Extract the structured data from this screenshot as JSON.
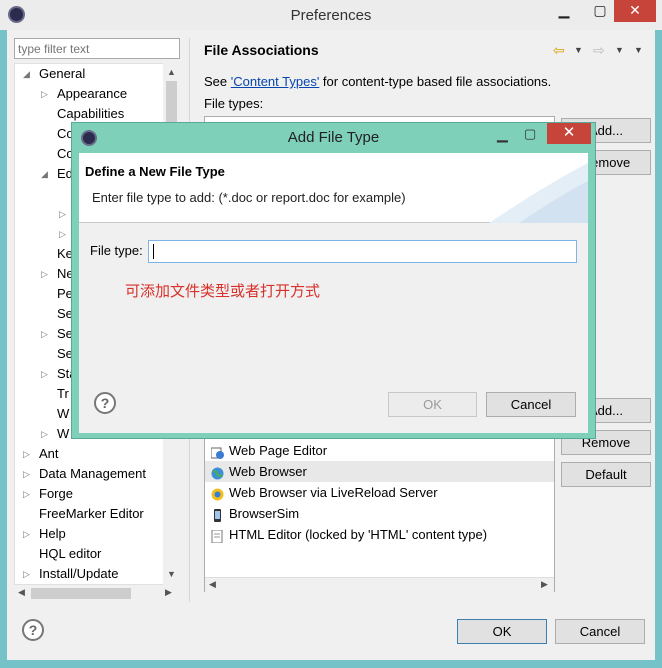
{
  "window": {
    "title": "Preferences"
  },
  "filter": {
    "placeholder": "type filter text"
  },
  "tree": [
    {
      "label": "General",
      "arrow": "◢",
      "indent": 0
    },
    {
      "label": "Appearance",
      "arrow": "▷",
      "indent": 1
    },
    {
      "label": "Capabilities",
      "arrow": "",
      "indent": 1
    },
    {
      "label": "Co",
      "arrow": "",
      "indent": 1
    },
    {
      "label": "Co",
      "arrow": "",
      "indent": 1
    },
    {
      "label": "Ed",
      "arrow": "◢",
      "indent": 1
    },
    {
      "label": "",
      "arrow": "",
      "indent": 2
    },
    {
      "label": "",
      "arrow": "▷",
      "indent": 2
    },
    {
      "label": "",
      "arrow": "▷",
      "indent": 2
    },
    {
      "label": "Ke",
      "arrow": "",
      "indent": 1
    },
    {
      "label": "Ne",
      "arrow": "▷",
      "indent": 1
    },
    {
      "label": "Pe",
      "arrow": "",
      "indent": 1
    },
    {
      "label": "Se",
      "arrow": "",
      "indent": 1
    },
    {
      "label": "Se",
      "arrow": "▷",
      "indent": 1
    },
    {
      "label": "Se",
      "arrow": "",
      "indent": 1
    },
    {
      "label": "Sta",
      "arrow": "▷",
      "indent": 1
    },
    {
      "label": "Tr",
      "arrow": "",
      "indent": 1
    },
    {
      "label": "W",
      "arrow": "",
      "indent": 1
    },
    {
      "label": "W",
      "arrow": "▷",
      "indent": 1
    },
    {
      "label": "Ant",
      "arrow": "▷",
      "indent": 0
    },
    {
      "label": "Data Management",
      "arrow": "▷",
      "indent": 0
    },
    {
      "label": "Forge",
      "arrow": "▷",
      "indent": 0
    },
    {
      "label": "FreeMarker Editor",
      "arrow": "",
      "indent": 0
    },
    {
      "label": "Help",
      "arrow": "▷",
      "indent": 0
    },
    {
      "label": "HQL editor",
      "arrow": "",
      "indent": 0
    },
    {
      "label": "Install/Update",
      "arrow": "▷",
      "indent": 0
    }
  ],
  "page": {
    "title": "File Associations",
    "see_prefix": "See ",
    "see_link": "'Content Types'",
    "see_suffix": " for content-type based file associations.",
    "file_types_label": "File types:",
    "add_top": "Add...",
    "remove_top": "Remove",
    "add_bottom": "Add...",
    "remove_bottom": "Remove",
    "default": "Default",
    "editors": [
      {
        "label": "Web Page Editor",
        "icon": "web-page-editor-icon",
        "selected": false
      },
      {
        "label": "Web Browser",
        "icon": "globe-icon",
        "selected": true
      },
      {
        "label": "Web Browser via LiveReload Server",
        "icon": "livereload-icon",
        "selected": false
      },
      {
        "label": "BrowserSim",
        "icon": "phone-icon",
        "selected": false
      },
      {
        "label": "HTML Editor (locked by 'HTML' content type)",
        "icon": "document-icon",
        "selected": false
      }
    ]
  },
  "footer": {
    "ok": "OK",
    "cancel": "Cancel"
  },
  "dialog": {
    "title": "Add File Type",
    "heading": "Define a New File Type",
    "description": "Enter file type to add: (*.doc or report.doc for example)",
    "file_type_label": "File type:",
    "file_type_value": "",
    "annotation": "可添加文件类型或者打开方式",
    "ok": "OK",
    "cancel": "Cancel"
  }
}
